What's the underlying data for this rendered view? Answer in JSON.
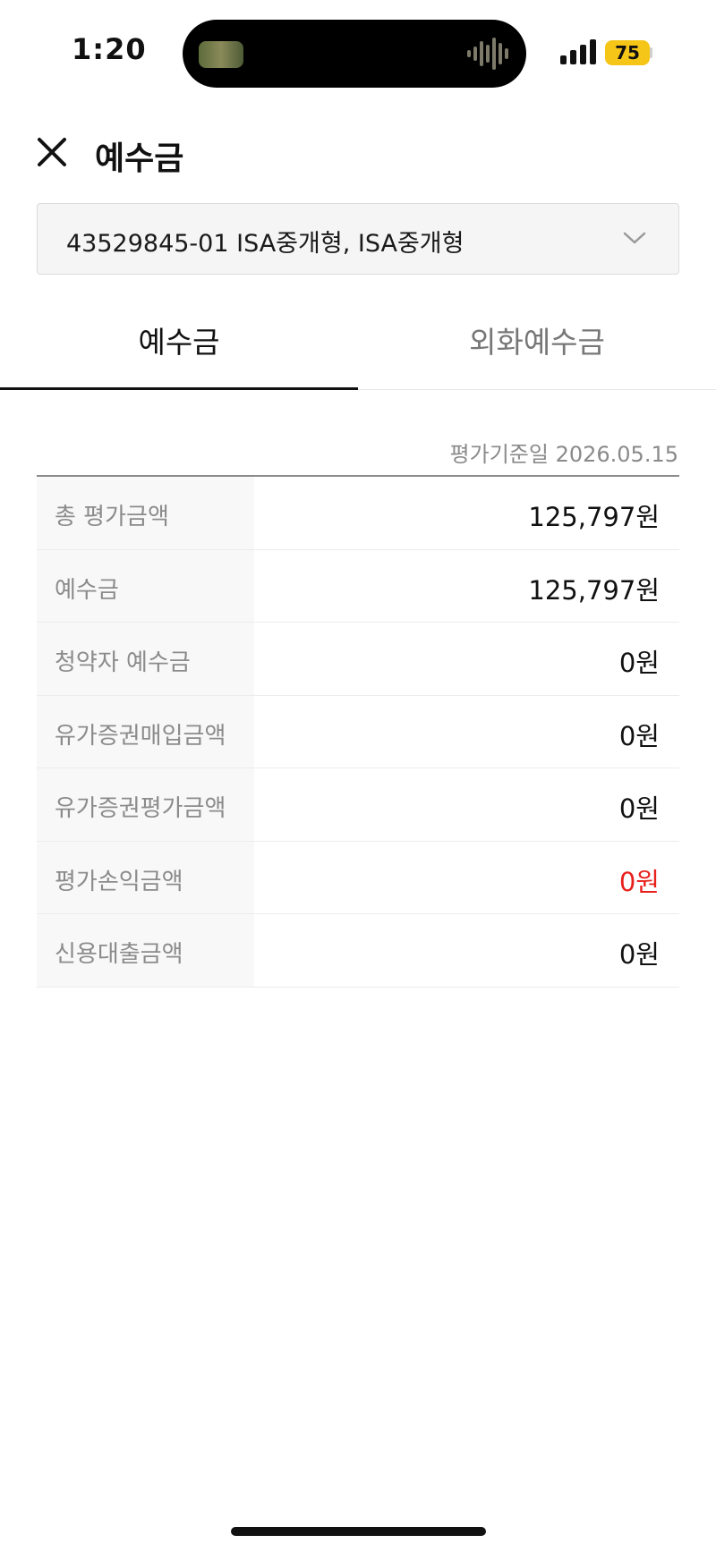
{
  "status_bar": {
    "time": "1:20",
    "battery_level": "75"
  },
  "header": {
    "title": "예수금",
    "close_icon": "close-icon"
  },
  "account": {
    "selected": "43529845-01 ISA중개형, ISA중개형",
    "icon": "chevron-down-icon"
  },
  "tabs": [
    {
      "label": "예수금",
      "active": true
    },
    {
      "label": "외화예수금",
      "active": false
    }
  ],
  "evaluation_date": "평가기준일 2026.05.15",
  "rows": [
    {
      "label": "총 평가금액",
      "value": "125,797원"
    },
    {
      "label": "예수금",
      "value": "125,797원"
    },
    {
      "label": "청약자 예수금",
      "value": "0원"
    },
    {
      "label": "유가증권매입금액",
      "value": "0원"
    },
    {
      "label": "유가증권평가금액",
      "value": "0원"
    },
    {
      "label": "평가손익금액",
      "value": "0원",
      "highlight_color": "#e8201c"
    },
    {
      "label": "신용대출금액",
      "value": "0원"
    }
  ]
}
